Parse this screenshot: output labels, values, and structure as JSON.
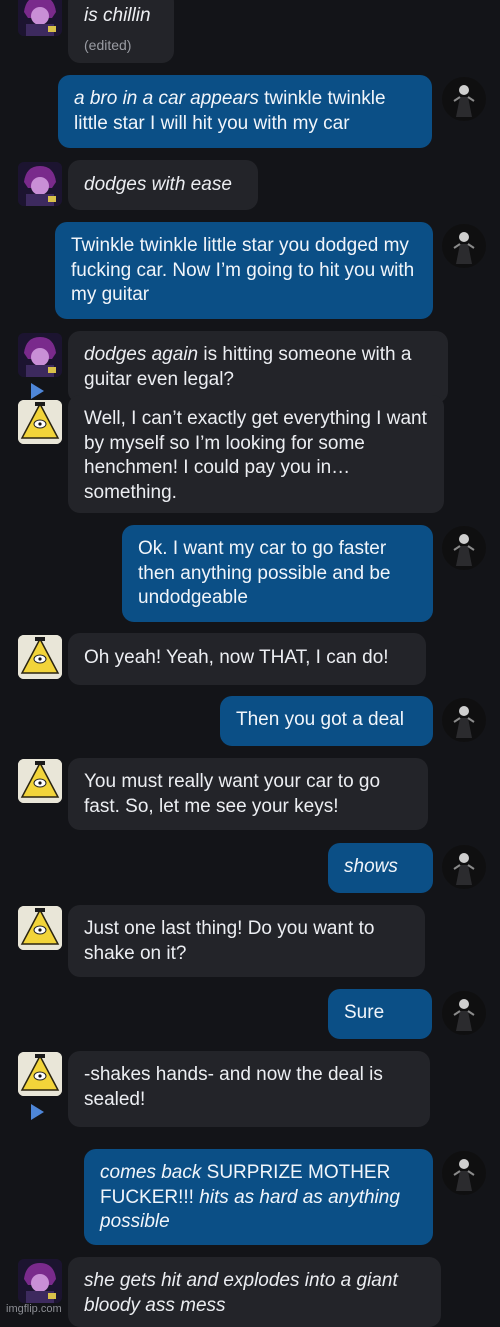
{
  "messages": [
    {
      "side": "in",
      "avatar": "purple",
      "segments": [
        {
          "t": "is chillin",
          "i": true
        }
      ],
      "edited": "(edited)"
    },
    {
      "side": "out",
      "avatar": "dark",
      "segments": [
        {
          "t": "a bro in a car appears",
          "i": true
        },
        {
          "t": " twinkle twinkle little star I will hit you with my car",
          "i": false
        }
      ]
    },
    {
      "side": "in",
      "avatar": "purple",
      "segments": [
        {
          "t": "dodges with ease",
          "i": true
        }
      ]
    },
    {
      "side": "out",
      "avatar": "dark",
      "segments": [
        {
          "t": "Twinkle twinkle little star you dodged my fucking car. Now I’m going to hit you with my guitar",
          "i": false
        }
      ]
    },
    {
      "side": "in",
      "avatar": "purple",
      "segments": [
        {
          "t": "dodges again",
          "i": true
        },
        {
          "t": " is hitting someone with a guitar even legal?",
          "i": false
        }
      ]
    },
    {
      "side": "in",
      "avatar": "bill",
      "segments": [
        {
          "t": "Well, I can’t exactly get everything I want by myself so I’m looking for some henchmen! I could pay you in… something.",
          "i": false
        }
      ]
    },
    {
      "side": "out",
      "avatar": "dark",
      "segments": [
        {
          "t": "Ok. I want my car to go faster then anything possible and be undodgeable",
          "i": false
        }
      ]
    },
    {
      "side": "in",
      "avatar": "bill",
      "segments": [
        {
          "t": "Oh yeah! Yeah,  now THAT, I can do!",
          "i": false
        }
      ]
    },
    {
      "side": "out",
      "avatar": "dark",
      "segments": [
        {
          "t": "Then you got a deal",
          "i": false
        }
      ]
    },
    {
      "side": "in",
      "avatar": "bill",
      "segments": [
        {
          "t": "You must really want your car to go fast.  So, let me see your keys!",
          "i": false
        }
      ]
    },
    {
      "side": "out",
      "avatar": "dark",
      "segments": [
        {
          "t": "shows",
          "i": true
        }
      ]
    },
    {
      "side": "in",
      "avatar": "bill",
      "segments": [
        {
          "t": "Just one last thing! Do you want to shake on it?",
          "i": false
        }
      ]
    },
    {
      "side": "out",
      "avatar": "dark",
      "segments": [
        {
          "t": "Sure",
          "i": false
        }
      ]
    },
    {
      "side": "in",
      "avatar": "bill",
      "segments": [
        {
          "t": "-shakes hands-  and now the deal is sealed!",
          "i": false
        }
      ]
    },
    {
      "side": "out",
      "avatar": "dark",
      "segments": [
        {
          "t": "comes back",
          "i": true
        },
        {
          "t": " SURPRIZE MOTHER FUCKER!!! ",
          "i": false
        },
        {
          "t": "hits as hard as anything possible",
          "i": true
        }
      ]
    },
    {
      "side": "in",
      "avatar": "purple",
      "segments": [
        {
          "t": "she gets hit and explodes into a giant bloody ass mess",
          "i": true
        }
      ]
    }
  ],
  "watermark": "imgflip.com",
  "colors": {
    "background": "#131418",
    "incoming": "#232429",
    "outgoing": "#0b4f86",
    "arrow": "#4e86d8"
  }
}
